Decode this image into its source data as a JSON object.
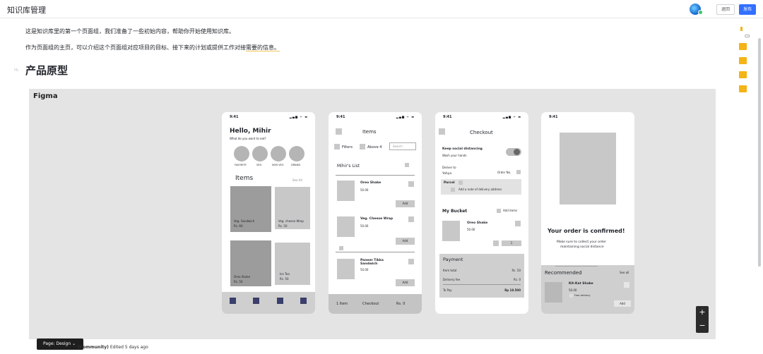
{
  "app": {
    "title": "知识库管理",
    "exit_label": "退回",
    "publish_label": "发布"
  },
  "doc": {
    "intro1": "这是知识库里的第一个页面组，我们准备了一些初始内容，帮助你开始使用知识库。",
    "intro2_a": "作为页面组的主页，可以介绍这个页面组对应项目的目标、接下来的计划或提供工作对接",
    "intro2_b": "需要的信息。",
    "heading_marker": "H₁",
    "heading": "产品原型"
  },
  "figma": {
    "label": "Figma",
    "page_tag": "Page: Design ⌄",
    "footer_bold": "(Community)",
    "footer_rest": " Edited 5 days ago",
    "zoom_in": "+",
    "zoom_out": "−"
  },
  "status": {
    "time": "9:41",
    "icons": "▂▄▆ ᯤ ▬"
  },
  "home": {
    "greeting": "Hello, Mihir",
    "subtitle": "What do you want to eat?",
    "categories": [
      "FAVORITE",
      "VEG",
      "NON VEG",
      "DRINKS"
    ],
    "items_title": "Items",
    "see_all": "See All",
    "cards": [
      {
        "name": "Veg. Sandwich",
        "price": "Rs. 60"
      },
      {
        "name": "Veg. cheese Wrap",
        "price": "Rs. 50"
      },
      {
        "name": "Oreo Shake",
        "price": "Rs. 50"
      },
      {
        "name": "Ice Tea",
        "price": "Rs. 50"
      }
    ]
  },
  "items": {
    "title": "Items",
    "filters": "Filters",
    "above": "Above 4",
    "search_placeholder": "Search",
    "list_title": "Mihir's List",
    "products": [
      {
        "name": "Oreo Shake",
        "price": "50.00",
        "add": "Add"
      },
      {
        "name": "Veg. Cheese Wrap",
        "price": "50.00",
        "add": "Add"
      },
      {
        "name": "Paneer Tikka Sandwich",
        "price": "50.00",
        "add": "Add"
      }
    ],
    "footer_item": "1 Item",
    "footer_checkout": "Checkout",
    "footer_price": "Rs. 0"
  },
  "checkout": {
    "title": "Checkout",
    "distancing": "Keep social distancing",
    "wash": "Wash your hands",
    "deliver_to": "Deliver to",
    "name": "Yahya",
    "order_no": "Order No.",
    "parcel": "Parcel",
    "note": "Add a note of delivery address",
    "bucket": "My Bucket",
    "add_items": "Add items",
    "bucket_item": "Oreo Shake",
    "bucket_price": "50.00",
    "qty": "1",
    "payment": "Payment",
    "item_total_label": "Item total",
    "item_total": "Rs. 50",
    "delivery_label": "Delivery fee",
    "delivery": "Rs. 0",
    "topay_label": "To Pay",
    "topay": "Rp 18.500"
  },
  "confirm": {
    "title": "Your order is confirmed!",
    "subtitle1": "Make sure to collect your order",
    "subtitle2": "maintaining social distance",
    "recommended": "Recommended",
    "see_all": "See all",
    "item": "Kit-Kat Shake",
    "price": "50.00",
    "free_delivery": "Free delivery",
    "add": "Add"
  }
}
